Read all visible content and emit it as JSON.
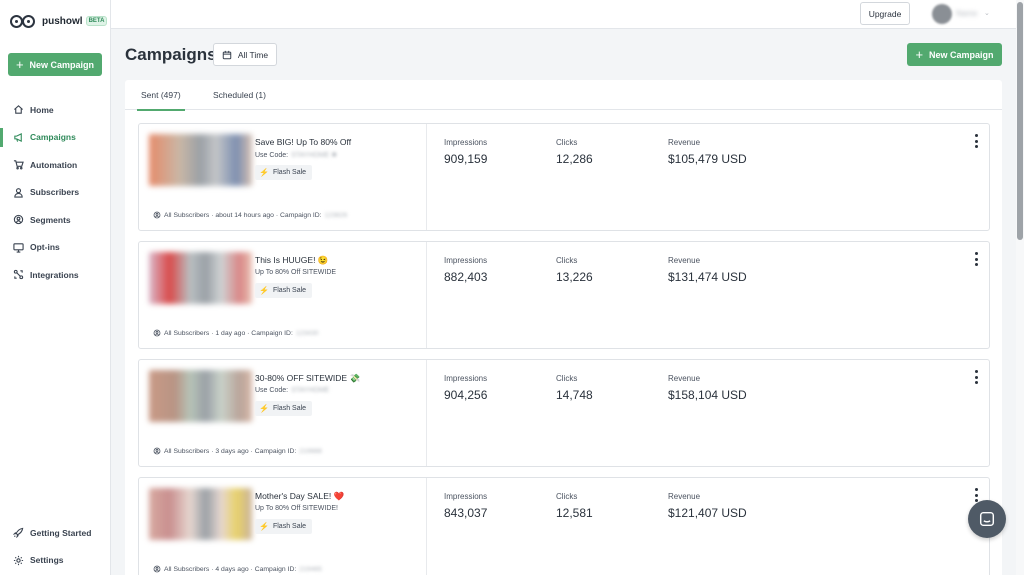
{
  "brand": {
    "name": "pushowl",
    "badge": "BETA"
  },
  "sidebar": {
    "new_campaign": "New Campaign",
    "items": [
      {
        "label": "Home",
        "icon": "home-icon"
      },
      {
        "label": "Campaigns",
        "icon": "megaphone-icon",
        "active": true
      },
      {
        "label": "Automation",
        "icon": "cart-icon"
      },
      {
        "label": "Subscribers",
        "icon": "user-icon"
      },
      {
        "label": "Segments",
        "icon": "segments-icon"
      },
      {
        "label": "Opt-ins",
        "icon": "monitor-icon"
      },
      {
        "label": "Integrations",
        "icon": "integrations-icon"
      }
    ],
    "bottom": [
      {
        "label": "Getting Started",
        "icon": "rocket-icon"
      },
      {
        "label": "Settings",
        "icon": "gear-icon"
      }
    ]
  },
  "topbar": {
    "upgrade": "Upgrade",
    "user": "Name"
  },
  "header": {
    "title": "Campaigns",
    "date_filter": "All Time",
    "new_campaign": "New Campaign"
  },
  "tabs": [
    {
      "label": "Sent (497)",
      "active": true
    },
    {
      "label": "Scheduled (1)"
    }
  ],
  "stat_labels": {
    "impressions": "Impressions",
    "clicks": "Clicks",
    "revenue": "Revenue"
  },
  "campaigns": [
    {
      "title": "Save BIG! Up To 80% Off",
      "subtitle": "Use Code:",
      "subtitle_hidden": "STAYHOME ✱",
      "badge": "Flash Sale",
      "audience": "All Subscribers",
      "time": "about 14 hours ago",
      "id_label": "Campaign ID:",
      "id_hidden": "123826",
      "impressions": "909,159",
      "clicks": "12,286",
      "revenue": "$105,479 USD"
    },
    {
      "title": "This Is HUUGE! 😉",
      "subtitle": "Up To 80% Off SITEWIDE",
      "subtitle_hidden": "",
      "badge": "Flash Sale",
      "audience": "All Subscribers",
      "time": "1 day ago",
      "id_label": "Campaign ID:",
      "id_hidden": "123430",
      "impressions": "882,403",
      "clicks": "13,226",
      "revenue": "$131,474 USD"
    },
    {
      "title": "30-80% OFF SITEWIDE 💸",
      "subtitle": "Use Code:",
      "subtitle_hidden": "STAYHOME",
      "badge": "Flash Sale",
      "audience": "All Subscribers",
      "time": "3 days ago",
      "id_label": "Campaign ID:",
      "id_hidden": "219888",
      "impressions": "904,256",
      "clicks": "14,748",
      "revenue": "$158,104 USD"
    },
    {
      "title": "Mother's Day SALE! ❤️",
      "subtitle": "Up To 80% Off SITEWIDE!",
      "subtitle_hidden": "",
      "badge": "Flash Sale",
      "audience": "All Subscribers",
      "time": "4 days ago",
      "id_label": "Campaign ID:",
      "id_hidden": "219465",
      "impressions": "843,037",
      "clicks": "12,581",
      "revenue": "$121,407 USD"
    }
  ],
  "colors": {
    "accent": "#52a96f",
    "text": "#2c3440",
    "background": "#f3f5f7"
  }
}
